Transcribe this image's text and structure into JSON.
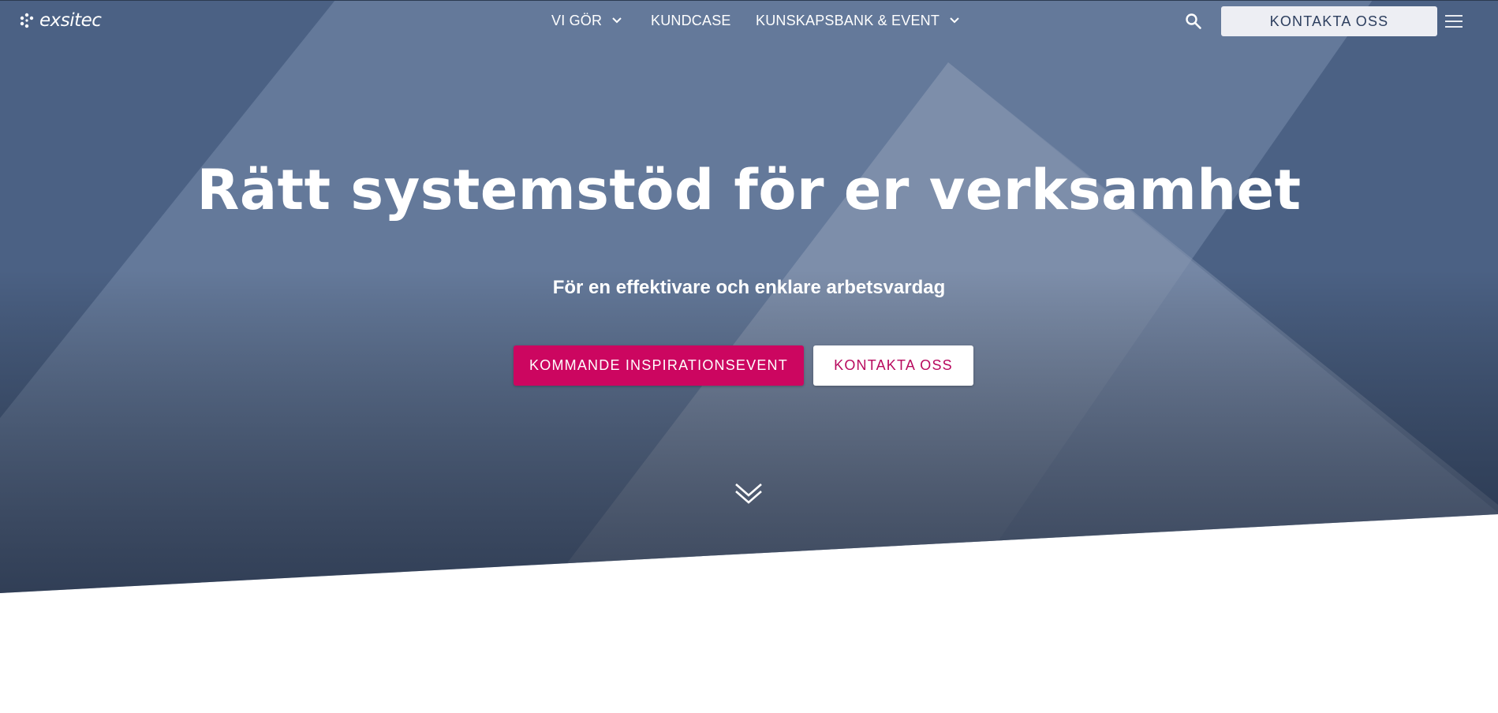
{
  "brand": {
    "logo_text": "exsitec"
  },
  "nav": {
    "items": [
      {
        "label": "VI GÖR"
      },
      {
        "label": "KUNDCASE"
      },
      {
        "label": "KUNSKAPSBANK & EVENT"
      }
    ],
    "contact_label": "KONTAKTA OSS"
  },
  "hero": {
    "title": "Rätt systemstöd för er verksamhet",
    "subtitle": "För en effektivare och enklare arbetsvardag",
    "primary_button": "KOMMANDE INSPIRATIONSEVENT",
    "secondary_button": "KONTAKTA OSS"
  },
  "icons": {
    "logo_mark": "exsitec-dots-logo",
    "nav_dropdown": "chevron-down-icon",
    "search": "search-icon",
    "menu": "hamburger-menu-icon",
    "scroll_down": "double-chevron-down-icon"
  },
  "colors": {
    "hero_base": "#5e7291",
    "hero_dark": "#353f53",
    "accent": "#cc0660",
    "contact_text": "#b80a5e",
    "header_button_bg": "#edeef3",
    "header_button_text": "#2c3e5e"
  }
}
